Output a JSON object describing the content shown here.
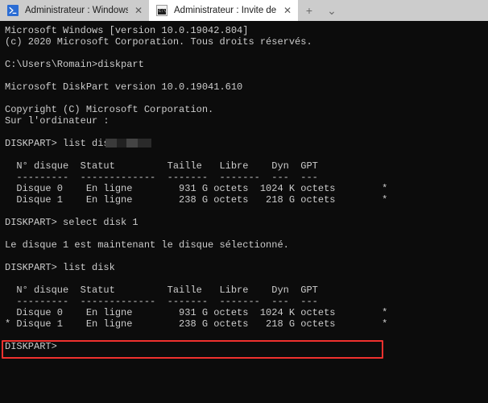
{
  "window": {
    "app": "Windows Terminal",
    "background_color": "#0c0c0c",
    "text_color": "#cccccc",
    "tabbar_color": "#cccccc"
  },
  "tabbar": {
    "tabs": [
      {
        "title": "Administrateur : Windows Powe",
        "icon": "powershell-icon",
        "active": false,
        "close_label": "✕"
      },
      {
        "title": "Administrateur : Invite de comm",
        "icon": "cmd-icon",
        "active": true,
        "close_label": "✕"
      }
    ],
    "new_tab_label": "+",
    "dropdown_label": "⌄",
    "cmd_icon_text": "C:\\"
  },
  "console": {
    "lines": [
      "Microsoft Windows [version 10.0.19042.804]",
      "(c) 2020 Microsoft Corporation. Tous droits réservés.",
      "",
      "C:\\Users\\Romain>diskpart",
      "",
      "Microsoft DiskPart version 10.0.19041.610",
      "",
      "Copyright (C) Microsoft Corporation.",
      "Sur l'ordinateur : ",
      "",
      "DISKPART> list disk",
      "",
      "  N° disque  Statut         Taille   Libre    Dyn  GPT",
      "  ---------  -------------  -------  -------  ---  ---",
      "  Disque 0    En ligne        931 G octets  1024 K octets        *",
      "  Disque 1    En ligne        238 G octets   218 G octets        *",
      "",
      "DISKPART> select disk 1",
      "",
      "Le disque 1 est maintenant le disque sélectionné.",
      "",
      "DISKPART> list disk",
      "",
      "  N° disque  Statut         Taille   Libre    Dyn  GPT",
      "  ---------  -------------  -------  -------  ---  ---",
      "  Disque 0    En ligne        931 G octets  1024 K octets        *",
      "* Disque 1    En ligne        238 G octets   218 G octets        *",
      "",
      "DISKPART>"
    ],
    "redacted_value": "",
    "table": {
      "headers": [
        "N° disque",
        "Statut",
        "Taille",
        "Libre",
        "Dyn",
        "GPT"
      ],
      "rows_first_listing": [
        {
          "selected": "",
          "disk": "Disque 0",
          "status": "En ligne",
          "size": "931 G octets",
          "free": "1024 K octets",
          "dyn": "",
          "gpt": "*"
        },
        {
          "selected": "",
          "disk": "Disque 1",
          "status": "En ligne",
          "size": "238 G octets",
          "free": "218 G octets",
          "dyn": "",
          "gpt": "*"
        }
      ],
      "rows_second_listing": [
        {
          "selected": "",
          "disk": "Disque 0",
          "status": "En ligne",
          "size": "931 G octets",
          "free": "1024 K octets",
          "dyn": "",
          "gpt": "*"
        },
        {
          "selected": "*",
          "disk": "Disque 1",
          "status": "En ligne",
          "size": "238 G octets",
          "free": "218 G octets",
          "dyn": "",
          "gpt": "*"
        }
      ]
    },
    "commands": [
      "diskpart",
      "list disk",
      "select disk 1",
      "list disk"
    ],
    "prompt": "DISKPART>"
  },
  "annotation": {
    "highlight_color": "#f0312e",
    "target_row": "* Disque 1    En ligne        238 G octets   218 G octets        *"
  }
}
